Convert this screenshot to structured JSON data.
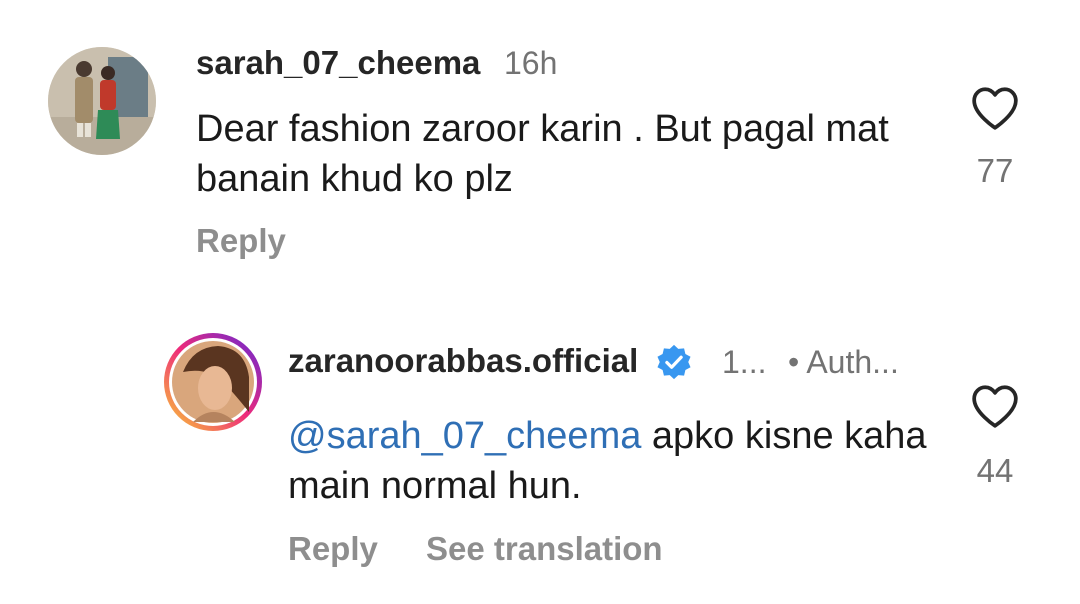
{
  "comments": [
    {
      "username": "sarah_07_cheema",
      "time": "16h",
      "text": "Dear fashion zaroor karin . But pagal mat banain khud ko plz",
      "likes": "77",
      "reply_label": "Reply",
      "avatar_icon": "user-photo-avatar"
    }
  ],
  "replies": [
    {
      "username": "zaranoorabbas.official",
      "verified_icon": "verified-badge-icon",
      "time": "1...",
      "author_badge": "• Auth...",
      "mention": "@sarah_07_cheema",
      "text": " apko kisne kaha main normal hun.",
      "likes": "44",
      "reply_label": "Reply",
      "translate_label": "See translation",
      "avatar_ring_colors": [
        "#f9ce34",
        "#ee2a7b",
        "#6228d7"
      ]
    }
  ],
  "colors": {
    "mention": "#2f6fb5",
    "verified": "#3897f0",
    "muted": "#737373"
  }
}
